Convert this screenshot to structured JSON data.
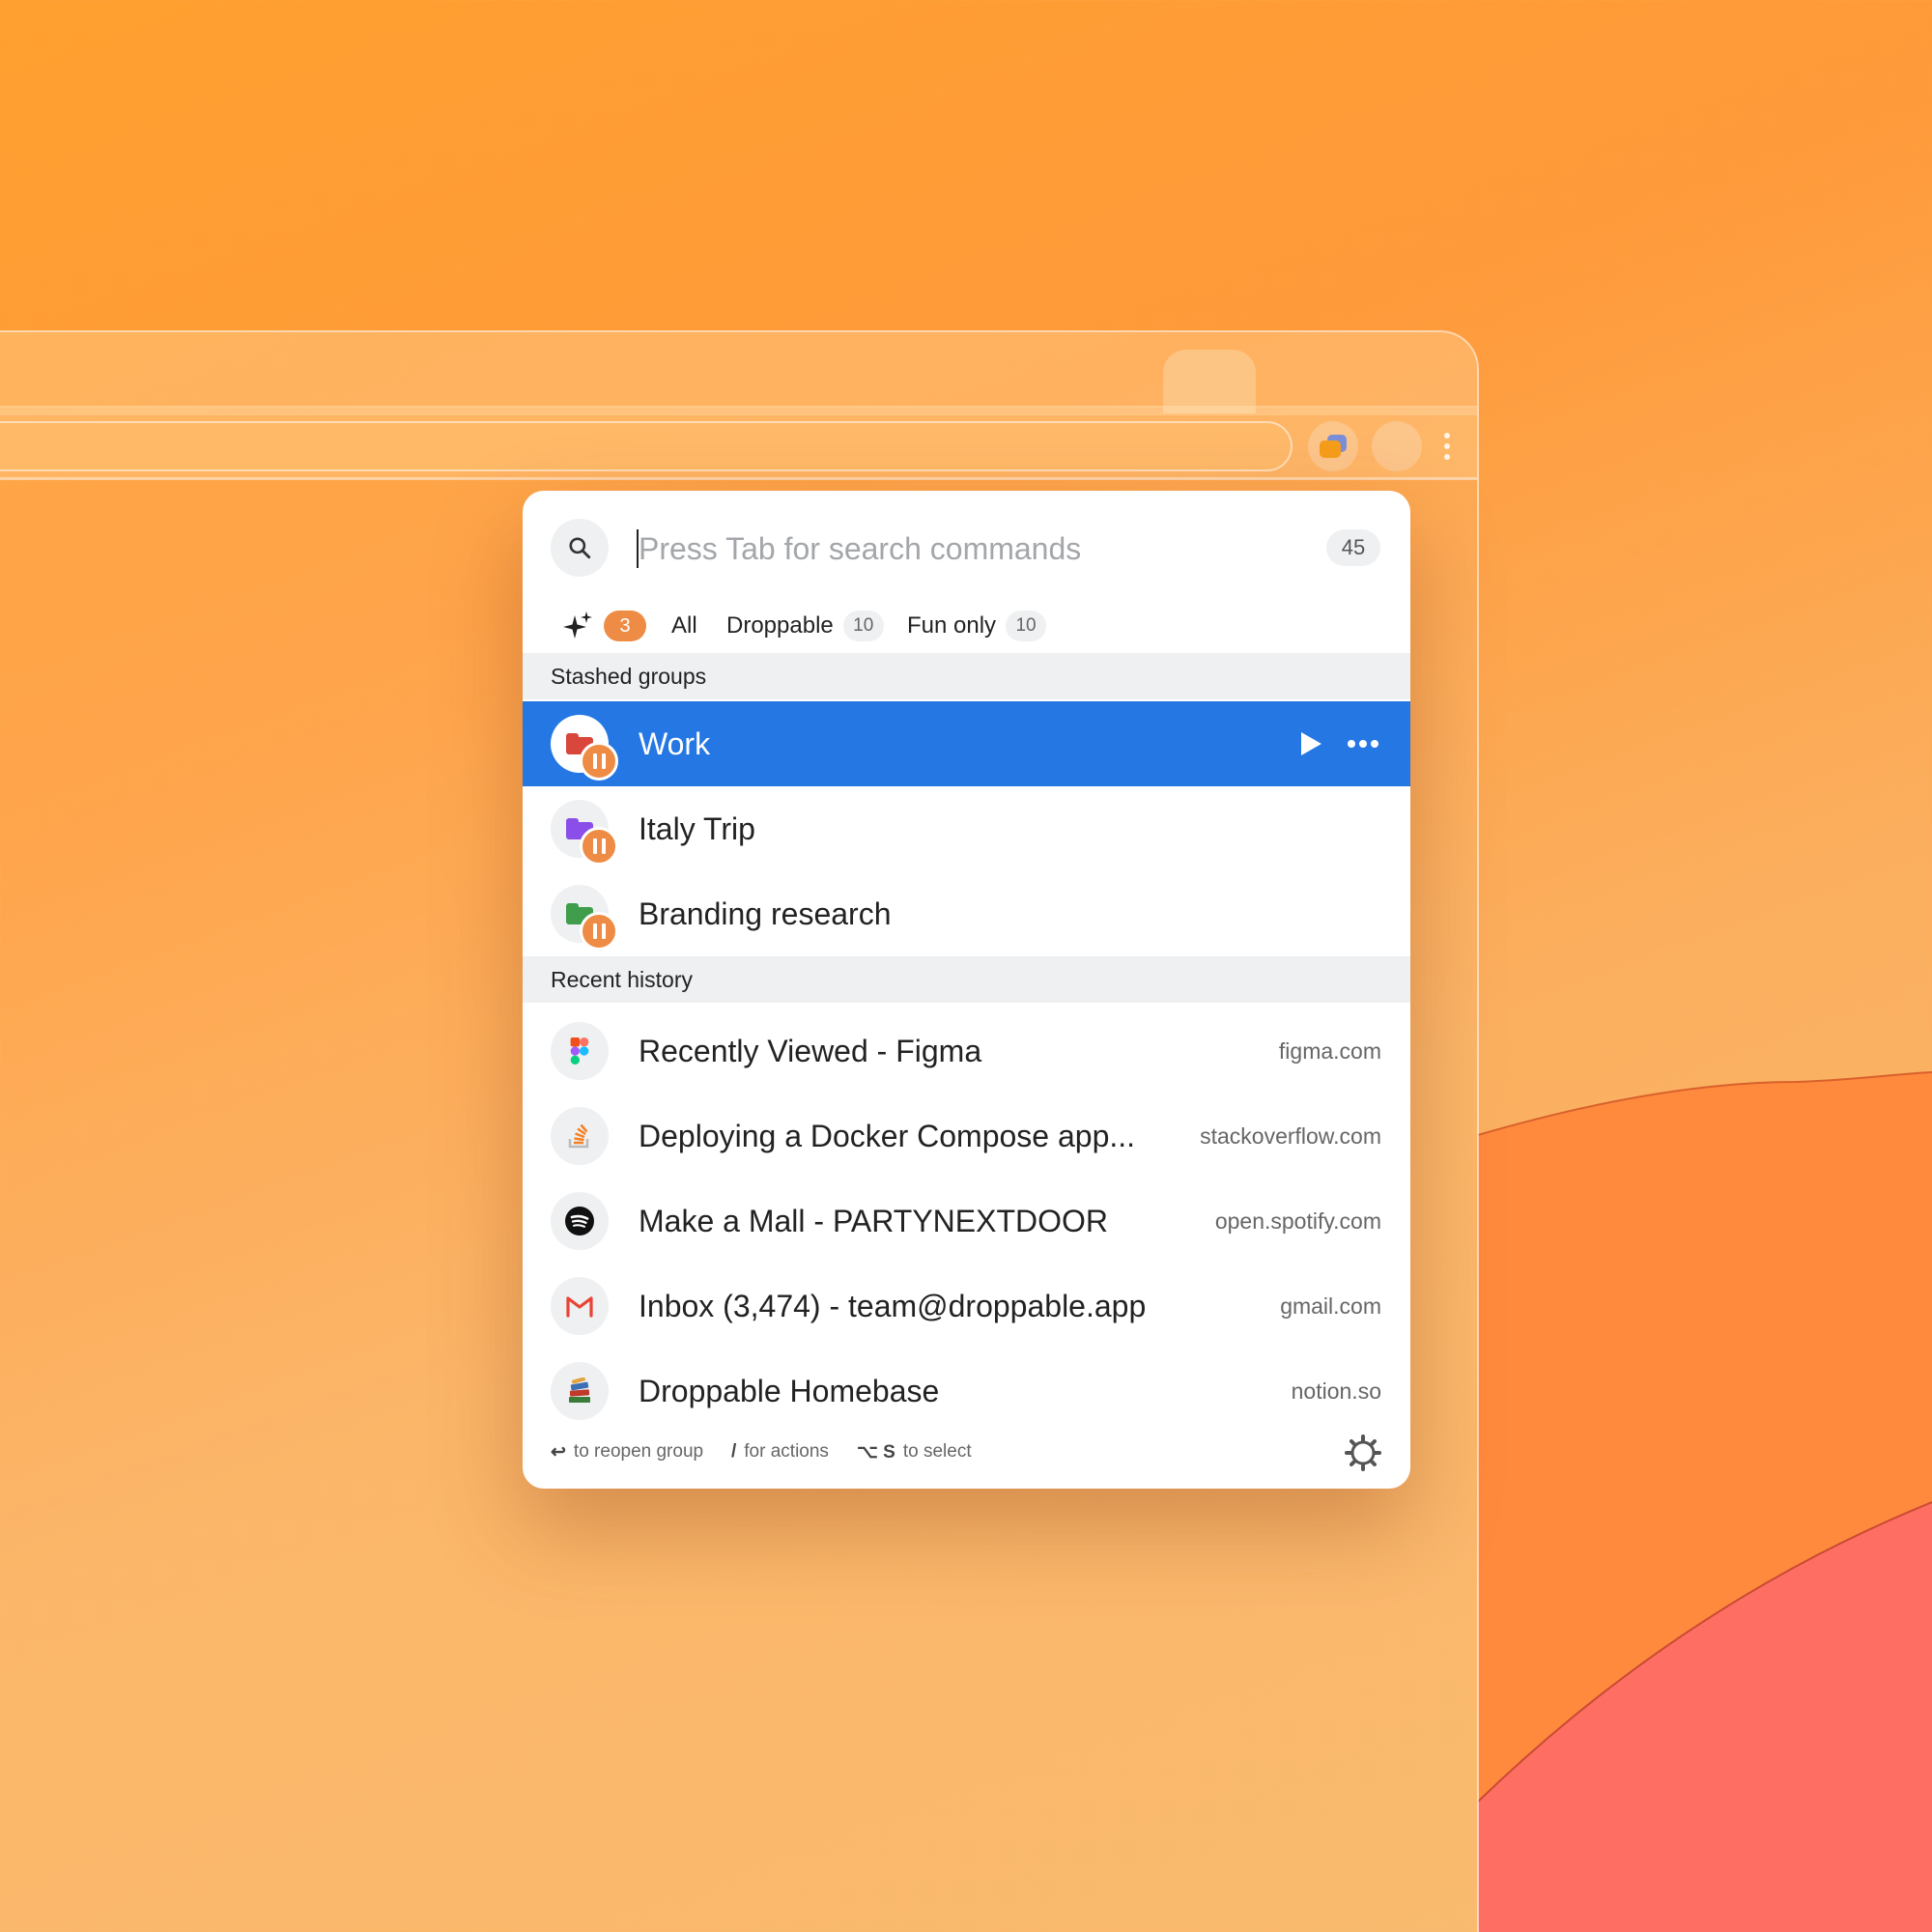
{
  "search": {
    "placeholder": "Press Tab for search commands",
    "value": "",
    "result_count": "45"
  },
  "filter_tabs": [
    {
      "label": "",
      "icon": "sparkle-icon",
      "count": "3",
      "active": true
    },
    {
      "label": "All",
      "count": ""
    },
    {
      "label": "Droppable",
      "count": "10"
    },
    {
      "label": "Fun only",
      "count": "10"
    }
  ],
  "sections": {
    "stashed": "Stashed groups",
    "history": "Recent history"
  },
  "stashed_groups": [
    {
      "title": "Work",
      "folder_color": "#d9463b",
      "status": "paused",
      "selected": true
    },
    {
      "title": "Italy Trip",
      "folder_color": "#8a4fe8",
      "status": "paused",
      "selected": false
    },
    {
      "title": "Branding research",
      "folder_color": "#3f9d4b",
      "status": "paused",
      "selected": false
    }
  ],
  "history": [
    {
      "title": "Recently Viewed - Figma",
      "domain": "figma.com",
      "icon": "figma-icon"
    },
    {
      "title": "Deploying a Docker Compose app...",
      "domain": "stackoverflow.com",
      "icon": "stackoverflow-icon"
    },
    {
      "title": "Make a Mall - PARTYNEXTDOOR",
      "domain": "open.spotify.com",
      "icon": "spotify-icon"
    },
    {
      "title": "Inbox (3,474) - team@droppable.app",
      "domain": "gmail.com",
      "icon": "gmail-icon"
    },
    {
      "title": "Droppable Homebase",
      "domain": "notion.so",
      "icon": "books-icon"
    }
  ],
  "footer": {
    "reopen_key": "↩",
    "reopen_text": "to reopen group",
    "actions_key": "/",
    "actions_text": "for actions",
    "select_key": "⌥ S",
    "select_text": "to select"
  },
  "colors": {
    "accent": "#2577e3",
    "badge_orange": "#ee8c45",
    "background_orange": "#ffa030",
    "background_coral": "#ff6e63"
  }
}
